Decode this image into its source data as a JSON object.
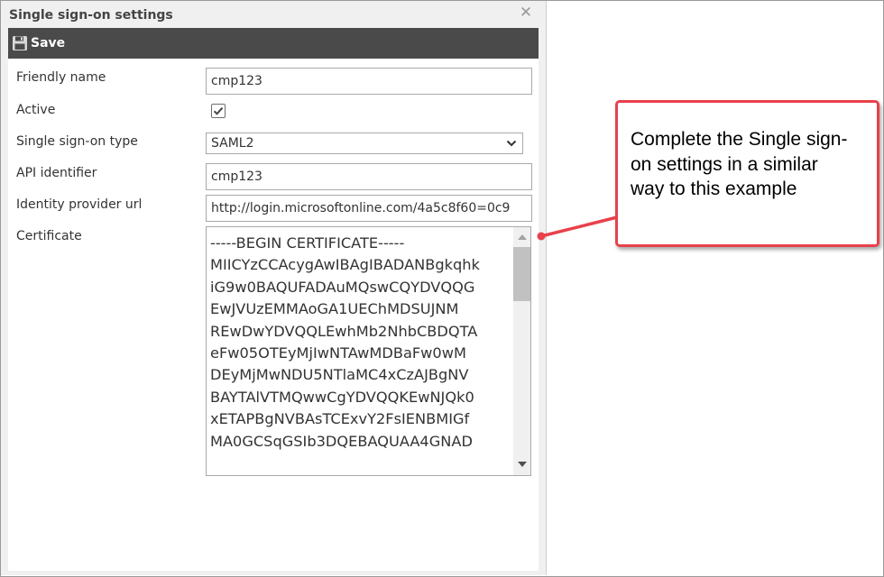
{
  "dialog": {
    "title": "Single sign-on settings",
    "close_icon": "close-icon",
    "toolbar": {
      "save_label": "Save",
      "save_icon": "floppy-disk-icon"
    }
  },
  "form": {
    "friendly_name": {
      "label": "Friendly name",
      "value": "cmp123"
    },
    "active": {
      "label": "Active",
      "checked": true
    },
    "sso_type": {
      "label": "Single sign-on type",
      "value": "SAML2"
    },
    "api_identifier": {
      "label": "API identifier",
      "value": "cmp123"
    },
    "idp_url": {
      "label": "Identity provider url",
      "value": "http://login.microsoftonline.com/4a5c8f60=0c9"
    },
    "certificate": {
      "label": "Certificate",
      "lines": [
        "-----BEGIN CERTIFICATE-----",
        "MIICYzCCAcygAwIBAgIBADANBgkqhk",
        "iG9w0BAQUFADAuMQswCQYDVQQG",
        "EwJVUzEMMAoGA1UEChMDSUJNM",
        "REwDwYDVQQLEwhMb2NhbCBDQTA",
        "eFw05OTEyMjIwNTAwMDBaFw0wM",
        "DEyMjMwNDU5NTlaMC4xCzAJBgNV",
        "BAYTAlVTMQwwCgYDVQQKEwNJQk0",
        "xETAPBgNVBAsTCExvY2FsIENBMIGf",
        "MA0GCSqGSIb3DQEBAQUAA4GNAD"
      ]
    }
  },
  "callout": {
    "text": "Complete the Single sign-on settings in a similar way to this example",
    "border_color": "#e8414b"
  },
  "colors": {
    "toolbar": "#4a4a4a",
    "dialog_bg": "#f0f0f0",
    "accent": "#e8414b"
  }
}
